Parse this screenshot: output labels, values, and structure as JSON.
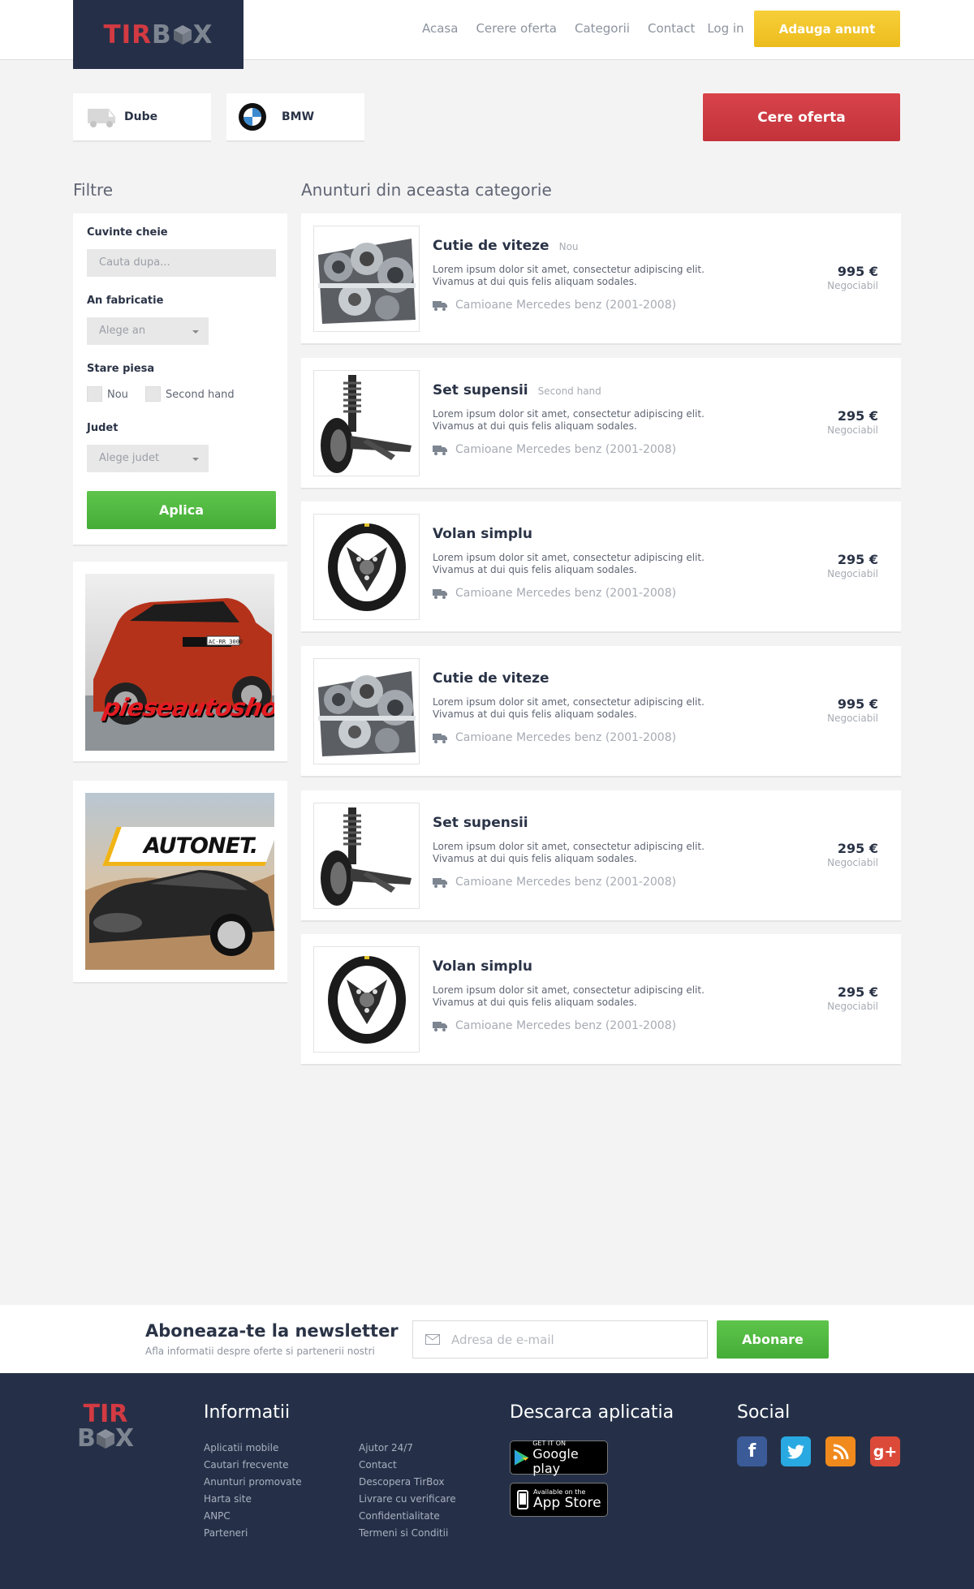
{
  "header": {
    "logo_left": "TIR",
    "logo_b": "B",
    "logo_x": "X",
    "nav": [
      "Acasa",
      "Cerere oferta",
      "Categorii",
      "Contact",
      "Log in"
    ],
    "add_button": "Adauga anunt"
  },
  "chips": [
    {
      "label": "Dube",
      "icon": "van-icon"
    },
    {
      "label": "BMW",
      "icon": "bmw-logo-icon"
    }
  ],
  "offer_button": "Cere oferta",
  "filters": {
    "title": "Filtre",
    "keywords_label": "Cuvinte cheie",
    "keywords_placeholder": "Cauta dupa...",
    "year_label": "An fabricatie",
    "year_value": "Alege an",
    "state_label": "Stare piesa",
    "state_new": "Nou",
    "state_used": "Second hand",
    "county_label": "Judet",
    "county_value": "Alege judet",
    "apply": "Aplica"
  },
  "ads": [
    {
      "brand": "pieseautoshop.ro",
      "plate": "AC-RR 3000"
    },
    {
      "brand": "AUTONET."
    }
  ],
  "listings_title": "Anunturi din aceasta categorie",
  "listings": [
    {
      "title": "Cutie de viteze",
      "tag": "Nou",
      "desc": "Lorem ipsum dolor sit amet, consectetur adipiscing elit. Vivamus at dui quis felis aliquam sodales.",
      "category": "Camioane Mercedes benz (2001-2008)",
      "price": "995 €",
      "note": "Negociabil",
      "img": "gearbox"
    },
    {
      "title": "Set supensii",
      "tag": "Second hand",
      "desc": "Lorem ipsum dolor sit amet, consectetur adipiscing elit. Vivamus at dui quis felis aliquam sodales.",
      "category": "Camioane Mercedes benz (2001-2008)",
      "price": "295 €",
      "note": "Negociabil",
      "img": "suspension"
    },
    {
      "title": "Volan simplu",
      "tag": "",
      "desc": "Lorem ipsum dolor sit amet, consectetur adipiscing elit. Vivamus at dui quis felis aliquam sodales.",
      "category": "Camioane Mercedes benz (2001-2008)",
      "price": "295 €",
      "note": "Negociabil",
      "img": "wheel"
    },
    {
      "title": "Cutie de viteze",
      "tag": "",
      "desc": "Lorem ipsum dolor sit amet, consectetur adipiscing elit. Vivamus at dui quis felis aliquam sodales.",
      "category": "Camioane Mercedes benz (2001-2008)",
      "price": "995 €",
      "note": "Negociabil",
      "img": "gearbox"
    },
    {
      "title": "Set supensii",
      "tag": "",
      "desc": "Lorem ipsum dolor sit amet, consectetur adipiscing elit. Vivamus at dui quis felis aliquam sodales.",
      "category": "Camioane Mercedes benz (2001-2008)",
      "price": "295 €",
      "note": "Negociabil",
      "img": "suspension"
    },
    {
      "title": "Volan simplu",
      "tag": "",
      "desc": "Lorem ipsum dolor sit amet, consectetur adipiscing elit. Vivamus at dui quis felis aliquam sodales.",
      "category": "Camioane Mercedes benz (2001-2008)",
      "price": "295 €",
      "note": "Negociabil",
      "img": "wheel"
    }
  ],
  "newsletter": {
    "title": "Aboneaza-te la newsletter",
    "subtitle": "Afla informatii despre oferte si partenerii nostri",
    "placeholder": "Adresa de e-mail",
    "button": "Abonare"
  },
  "footer": {
    "info_title": "Informatii",
    "col1": [
      "Aplicatii mobile",
      "Cautari frecvente",
      "Anunturi promovate",
      "Harta site",
      "ANPC",
      "Parteneri"
    ],
    "col2": [
      "Ajutor 24/7",
      "Contact",
      "Descopera TirBox",
      "Livrare cu verificare",
      "Confidentialitate",
      "Termeni si Conditii"
    ],
    "app_title": "Descarca aplicatia",
    "google_small": "GET IT ON",
    "google_big": "Google play",
    "apple_small": "Available on the",
    "apple_big": "App Store",
    "social_title": "Social",
    "social": [
      {
        "name": "facebook-icon",
        "glyph": "f",
        "color": "#3b5b98"
      },
      {
        "name": "twitter-icon",
        "glyph": "t",
        "color": "#29a9e1"
      },
      {
        "name": "rss-icon",
        "glyph": "r",
        "color": "#f08a1d"
      },
      {
        "name": "google-plus-icon",
        "glyph": "g+",
        "color": "#db4a39"
      }
    ]
  }
}
